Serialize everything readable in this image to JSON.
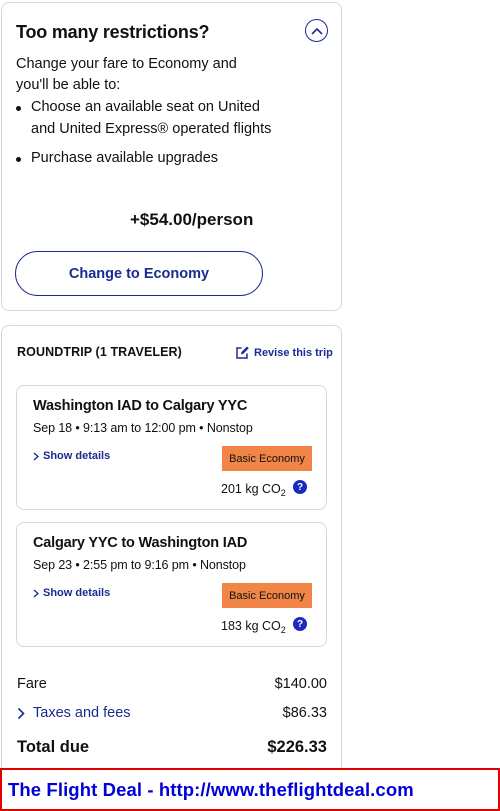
{
  "upsell": {
    "title": "Too many restrictions?",
    "intro": "Change your fare to Economy and you'll be able to:",
    "bullets": [
      "Choose an available seat on United and United Express® operated flights",
      "Purchase available upgrades"
    ],
    "price": "+$54.00/person",
    "button_label": "Change to Economy"
  },
  "trip": {
    "header": "ROUNDTRIP (1 TRAVELER)",
    "revise_label": "Revise this trip",
    "flights": [
      {
        "route": "Washington IAD to Calgary YYC",
        "times": "Sep 18 • 9:13 am to 12:00 pm • Nonstop",
        "details_label": "Show details",
        "fare_class": "Basic Economy",
        "co2_value": "201 kg CO",
        "co2_sub": "2"
      },
      {
        "route": "Calgary YYC to Washington IAD",
        "times": "Sep 23 • 2:55 pm to 9:16 pm • Nonstop",
        "details_label": "Show details",
        "fare_class": "Basic Economy",
        "co2_value": "183 kg CO",
        "co2_sub": "2"
      }
    ],
    "fare_label": "Fare",
    "fare_value": "$140.00",
    "taxes_label": "Taxes and fees",
    "taxes_value": "$86.33",
    "total_label": "Total due",
    "total_value": "$226.33"
  },
  "banner": {
    "text": "The Flight Deal - http://www.theflightdeal.com"
  },
  "colors": {
    "link_blue": "#1b2b8f",
    "badge_orange": "#f08547",
    "banner_red": "#e00000",
    "banner_text": "#0000d8"
  },
  "icons": [
    "chevron-up-icon",
    "edit-icon",
    "chevron-right-icon",
    "help-icon"
  ]
}
